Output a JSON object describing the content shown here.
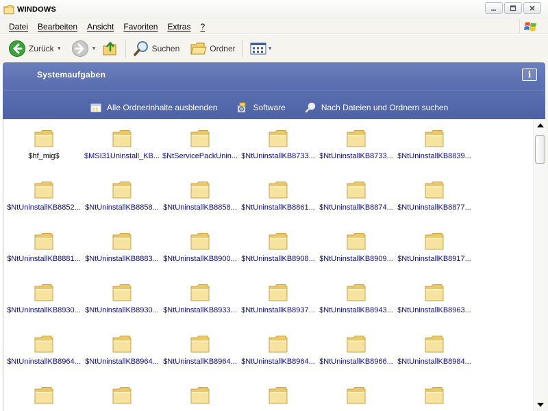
{
  "window": {
    "title": "WINDOWS"
  },
  "menu": [
    "Datei",
    "Bearbeiten",
    "Ansicht",
    "Favoriten",
    "Extras",
    "?"
  ],
  "toolbar": {
    "back_label": "Zurück",
    "search_label": "Suchen",
    "folders_label": "Ordner"
  },
  "taskpane": {
    "title": "Systemaufgaben",
    "info_glyph": "i",
    "tasks": [
      {
        "label": "Alle Ordnerinhalte ausblenden",
        "icon": "folder-hide-icon"
      },
      {
        "label": "Software",
        "icon": "software-icon"
      },
      {
        "label": "Nach Dateien und Ordnern suchen",
        "icon": "search-icon"
      }
    ]
  },
  "files": [
    "$hf_mig$",
    "$MSI31Uninstall_KB...",
    "$NtServicePackUnin...",
    "$NtUninstallKB8733...",
    "$NtUninstallKB8733...",
    "$NtUninstallKB8839...",
    "$NtUninstallKB8852...",
    "$NtUninstallKB8858...",
    "$NtUninstallKB8858...",
    "$NtUninstallKB8861...",
    "$NtUninstallKB8874...",
    "$NtUninstallKB8877...",
    "$NtUninstallKB8881...",
    "$NtUninstallKB8883...",
    "$NtUninstallKB8900...",
    "$NtUninstallKB8908...",
    "$NtUninstallKB8909...",
    "$NtUninstallKB8917...",
    "$NtUninstallKB8930...",
    "$NtUninstallKB8930...",
    "$NtUninstallKB8933...",
    "$NtUninstallKB8937...",
    "$NtUninstallKB8943...",
    "$NtUninstallKB8963...",
    "$NtUninstallKB8964...",
    "$NtUninstallKB8964...",
    "$NtUninstallKB8964...",
    "$NtUninstallKB8964...",
    "$NtUninstallKB8966...",
    "$NtUninstallKB8984...",
    "",
    "",
    "",
    "",
    "",
    ""
  ],
  "colors": {
    "taskpane_blue": "#5d71b2",
    "filename_blue": "#0a0a8c",
    "folder_yellow": "#f7e3a0"
  }
}
